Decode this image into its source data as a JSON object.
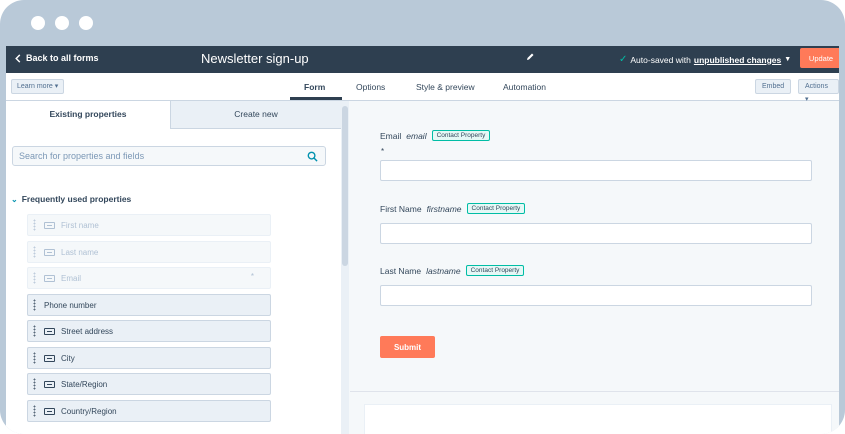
{
  "topbar": {
    "back_label": "Back to all forms",
    "form_title": "Newsletter sign-up",
    "autosave_prefix": "Auto-saved with",
    "autosave_link": "unpublished changes",
    "update_label": "Update"
  },
  "tabbar": {
    "learn_more": "Learn more",
    "tabs": [
      "Form",
      "Options",
      "Style & preview",
      "Automation"
    ],
    "active_tab": "Form",
    "embed_label": "Embed",
    "actions_label": "Actions"
  },
  "left_panel": {
    "subtabs": [
      "Existing properties",
      "Create new"
    ],
    "search_placeholder": "Search for properties and fields",
    "section_title": "Frequently used properties",
    "properties": [
      {
        "label": "First name",
        "state": "disabled"
      },
      {
        "label": "Last name",
        "state": "disabled"
      },
      {
        "label": "Email",
        "state": "disabled",
        "required_mark": "*"
      },
      {
        "label": "Phone number",
        "state": "enabled"
      },
      {
        "label": "Street address",
        "state": "enabled"
      },
      {
        "label": "City",
        "state": "enabled"
      },
      {
        "label": "State/Region",
        "state": "enabled"
      },
      {
        "label": "Country/Region",
        "state": "enabled"
      }
    ]
  },
  "form": {
    "fields": [
      {
        "label": "Email",
        "internal": "email",
        "badge": "Contact Property",
        "required_mark": "*"
      },
      {
        "label": "First Name",
        "internal": "firstname",
        "badge": "Contact Property"
      },
      {
        "label": "Last Name",
        "internal": "lastname",
        "badge": "Contact Property"
      }
    ],
    "submit_label": "Submit"
  },
  "colors": {
    "topbar_bg": "#2e3f50",
    "accent_orange": "#ff7a59",
    "teal": "#00bda5",
    "frame": "#b9c9d8"
  }
}
